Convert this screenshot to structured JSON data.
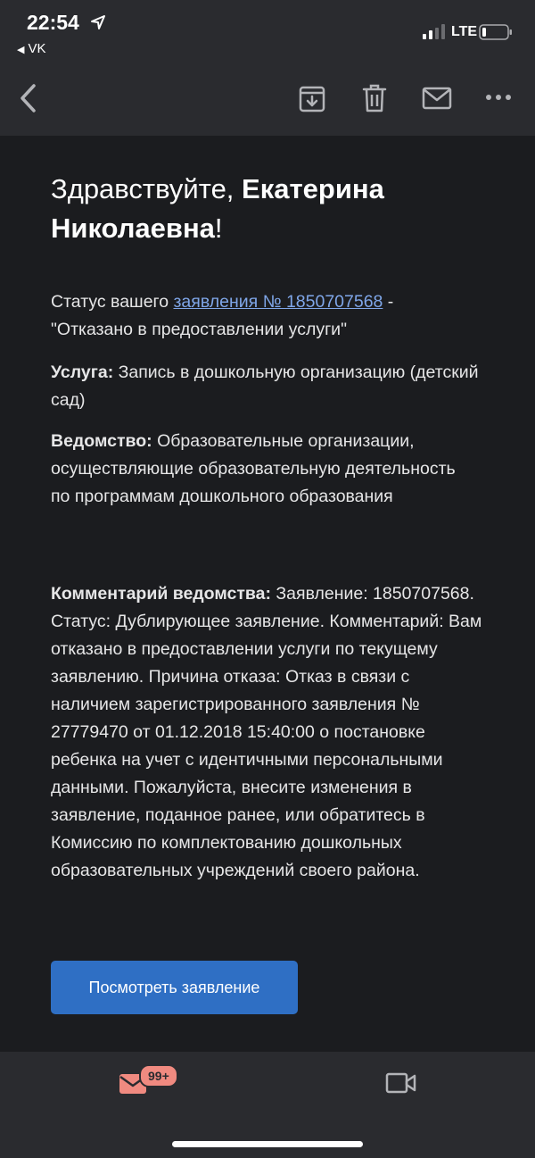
{
  "status_bar": {
    "time": "22:54",
    "back_app": "VK",
    "network": "LTE"
  },
  "toolbar": {
    "icons": [
      "back-icon",
      "archive-icon",
      "trash-icon",
      "mail-icon",
      "more-icon"
    ]
  },
  "email": {
    "greeting_prefix": "Здравствуйте, ",
    "greeting_name": "Екатерина Николаевна",
    "greeting_suffix": "!",
    "status_prefix": "Статус вашего ",
    "status_link": "заявления № 1850707568",
    "status_suffix": " - \"Отказано в предоставлении услуги\"",
    "service_label": "Услуга:",
    "service_value": " Запись в дошкольную организацию (детский сад)",
    "dept_label": "Ведомство:",
    "dept_value": " Образовательные организации, осуществляющие образовательную деятельность по программам дошкольного образования",
    "comment_label": "Комментарий ведомства:",
    "comment_value": " Заявление: 1850707568. Статус: Дублирующее заявление. Комментарий: Вам отказано в предоставлении услуги по текущему заявлению. Причина отказа: Отказ в связи с наличием зарегистрированного заявления № 27779470 от 01.12.2018 15:40:00 о постановке ребенка на учет с идентичными персональными данными. Пожалуйста, внесите изменения в заявление, поданное ранее, или обратитесь в Комиссию по комплектованию дошкольных образовательных учреждений своего района.",
    "button_label": "Посмотреть заявление"
  },
  "tabbar": {
    "mail_badge": "99+"
  },
  "colors": {
    "background": "#1b1c1f",
    "header": "#2a2b2f",
    "link": "#7fa6e8",
    "button": "#2f6fc4",
    "badge": "#f08a80"
  }
}
